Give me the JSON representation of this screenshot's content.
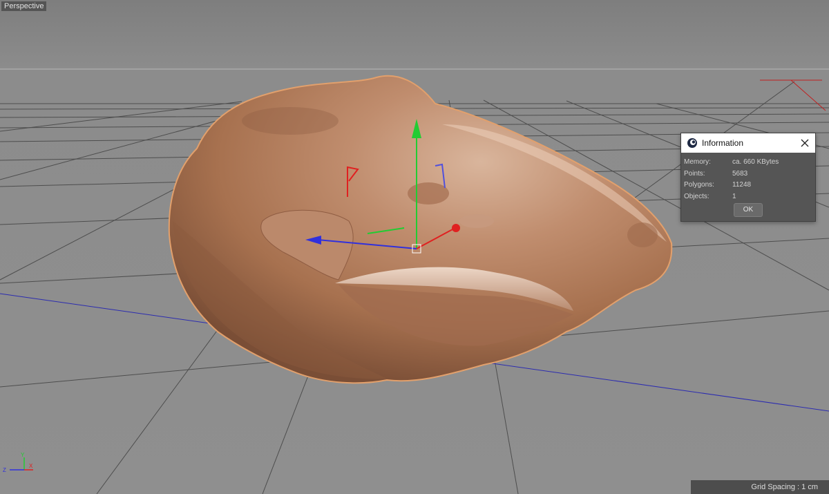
{
  "viewport": {
    "name": "Perspective",
    "grid_spacing": "Grid Spacing : 1 cm"
  },
  "axis_indicator": {
    "y": "Y",
    "z": "Z",
    "x": "X"
  },
  "info_dialog": {
    "title": "Information",
    "rows": [
      {
        "label": "Memory:",
        "value": "ca. 660 KBytes"
      },
      {
        "label": "Points:",
        "value": "5683"
      },
      {
        "label": "Polygons:",
        "value": "11248"
      },
      {
        "label": "Objects:",
        "value": "1"
      }
    ],
    "ok_label": "OK"
  },
  "colors": {
    "background": "#8f8f8f",
    "grid": "#4a4a4a",
    "x_axis": "#e02020",
    "y_axis": "#22cc33",
    "z_axis": "#3030dd",
    "model": "#b57f62"
  },
  "icons": [
    "cinema4d-icon",
    "close-icon",
    "object-axis-icon"
  ]
}
